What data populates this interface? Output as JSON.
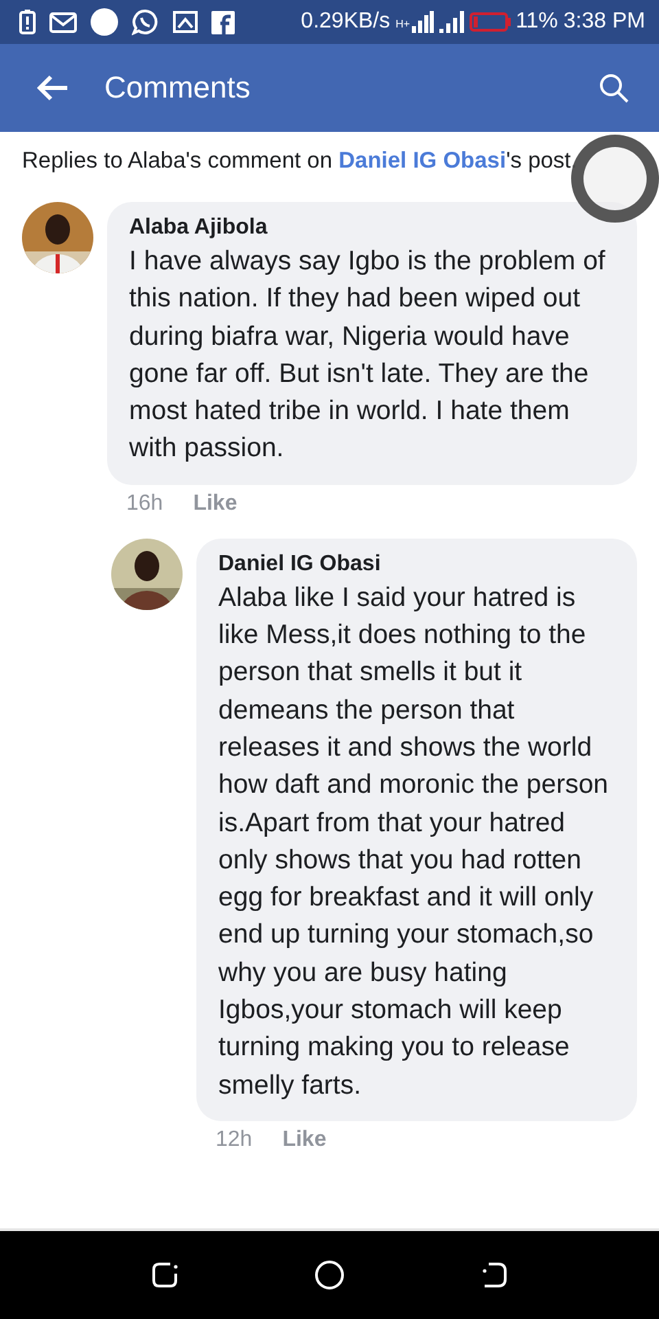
{
  "status_bar": {
    "network_speed": "0.29KB/s",
    "network_type": "H+",
    "battery": "11%",
    "battery_low": true,
    "time": "3:38 PM"
  },
  "app_bar": {
    "title": "Comments"
  },
  "context": {
    "before": "Replies to Alaba's comment on ",
    "link": "Daniel IG Obasi",
    "after": "'s post."
  },
  "comments": [
    {
      "author": "Alaba Ajibola",
      "text": "I have always say Igbo is the problem of this nation. If they had been wiped out during biafra war, Nigeria would have gone far off. But isn't late. They are the most hated tribe in world. I hate them with passion.",
      "time": "16h",
      "action": "Like",
      "reply": false
    },
    {
      "author": "Daniel IG Obasi",
      "text": "Alaba like I said your hatred is like Mess,it does nothing to the person that smells it but it demeans the person that releases it and shows the world how daft and moronic the person is.Apart from that your hatred only shows that you had rotten egg for breakfast and it will only end up turning your stomach,so why you are busy hating Igbos,your stomach will keep turning making you to release smelly farts.",
      "time": "12h",
      "action": "Like",
      "reply": true
    }
  ]
}
